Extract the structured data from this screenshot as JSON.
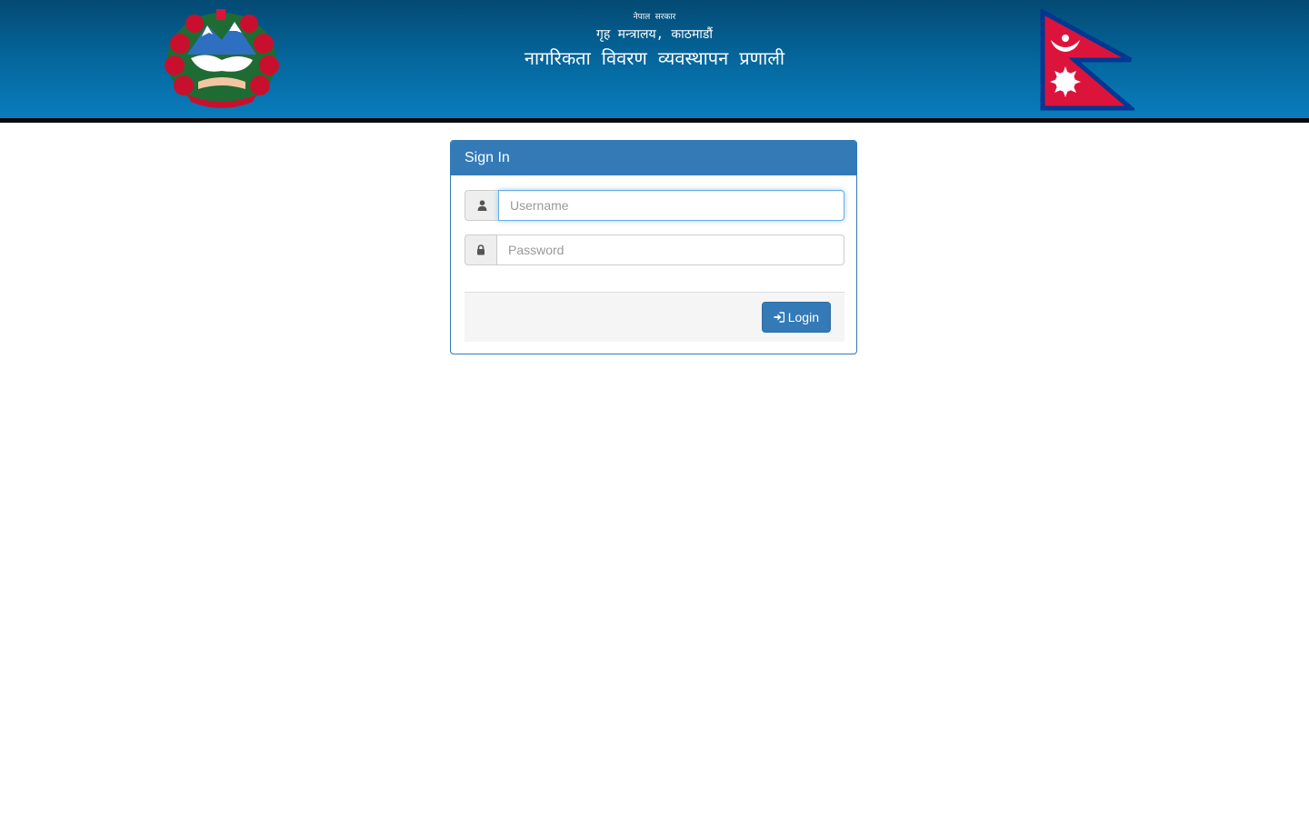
{
  "header": {
    "line1": "नेपाल सरकार",
    "line2": "गृह मन्त्रालय, काठमाडौं",
    "line3": "नागरिकता विवरण व्यवस्थापन प्रणाली",
    "emblem_icon": "nepal-emblem-icon",
    "flag_icon": "nepal-flag-icon"
  },
  "login": {
    "heading": "Sign In",
    "username_placeholder": "Username",
    "password_placeholder": "Password",
    "username_icon": "user-icon",
    "password_icon": "lock-icon",
    "submit_label": "Login",
    "submit_icon": "sign-in-icon"
  },
  "colors": {
    "header_top": "#034a73",
    "header_bottom": "#0a7cbc",
    "primary": "#337ab7",
    "flag_red": "#dc143c",
    "flag_blue": "#003893"
  }
}
